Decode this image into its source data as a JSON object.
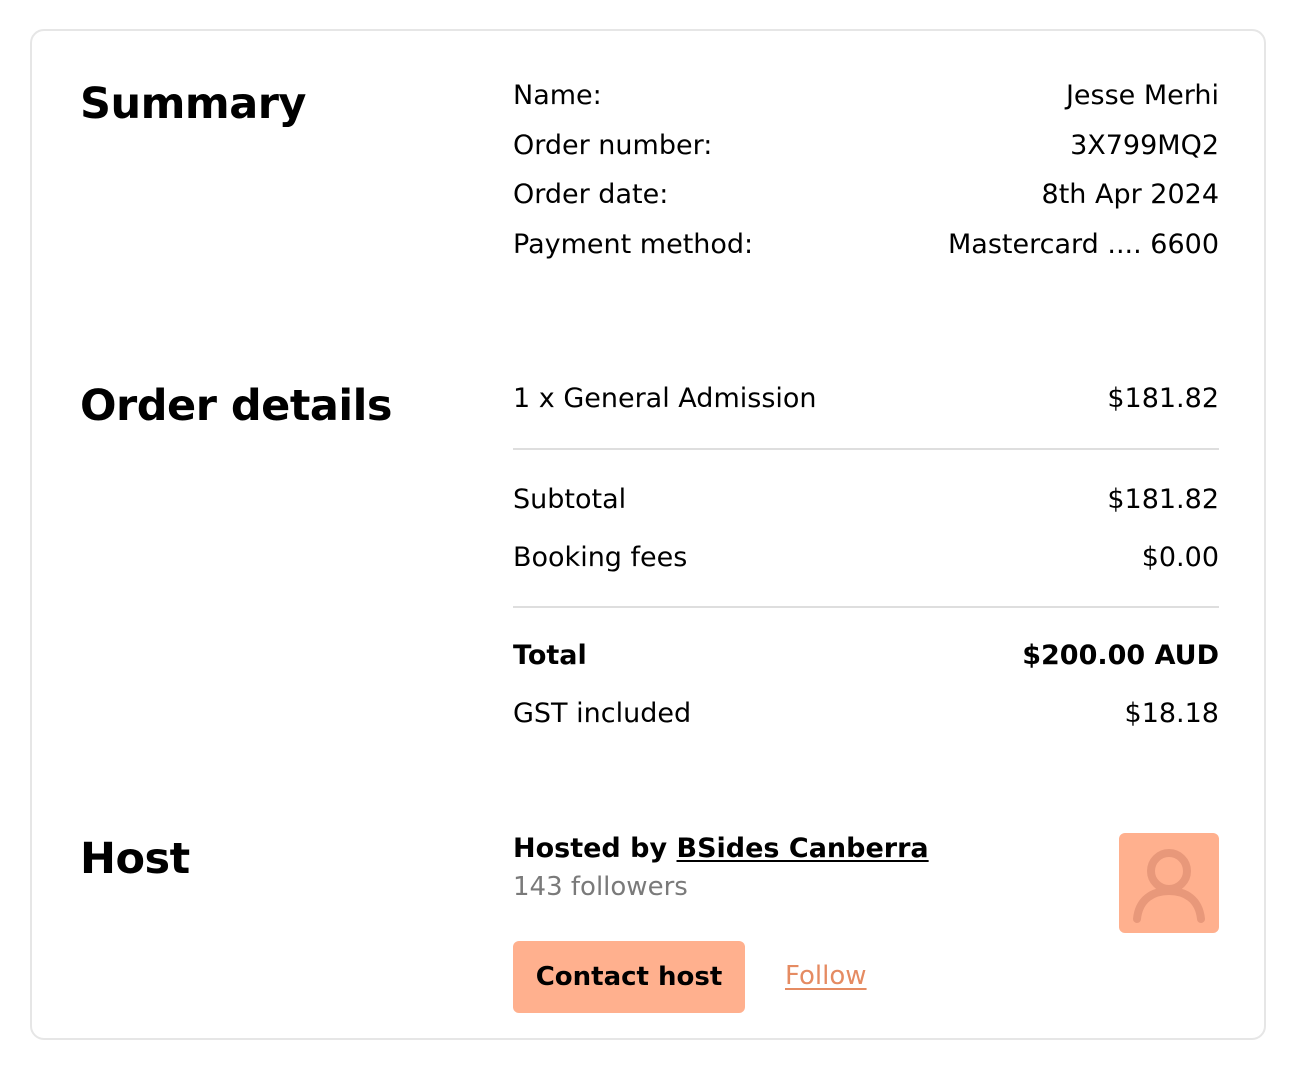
{
  "summary": {
    "title": "Summary",
    "fields": [
      {
        "label": "Name:",
        "value": "Jesse Merhi"
      },
      {
        "label": "Order number:",
        "value": "3X799MQ2"
      },
      {
        "label": "Order date:",
        "value": "8th Apr 2024"
      },
      {
        "label": "Payment method:",
        "value": "Mastercard .... 6600"
      }
    ]
  },
  "order_details": {
    "title": "Order details",
    "item": {
      "label": "1 x General Admission",
      "value": "$181.82"
    },
    "subtotal": {
      "label": "Subtotal",
      "value": "$181.82"
    },
    "booking_fees": {
      "label": "Booking fees",
      "value": "$0.00"
    },
    "total": {
      "label": "Total",
      "value": "$200.00 AUD"
    },
    "gst": {
      "label": "GST included",
      "value": "$18.18"
    }
  },
  "host": {
    "title": "Host",
    "hosted_by_prefix": "Hosted by",
    "host_name": "BSides Canberra",
    "followers": "143 followers",
    "contact_label": "Contact host",
    "follow_label": "Follow",
    "avatar_icon": "user-silhouette-icon"
  },
  "colors": {
    "accent": "#ffb08e",
    "accent_text": "#e58b62",
    "avatar_figure": "#e8987a",
    "muted_text": "#7a7a7a",
    "divider": "#dedede",
    "card_border": "#e6e6e6"
  }
}
